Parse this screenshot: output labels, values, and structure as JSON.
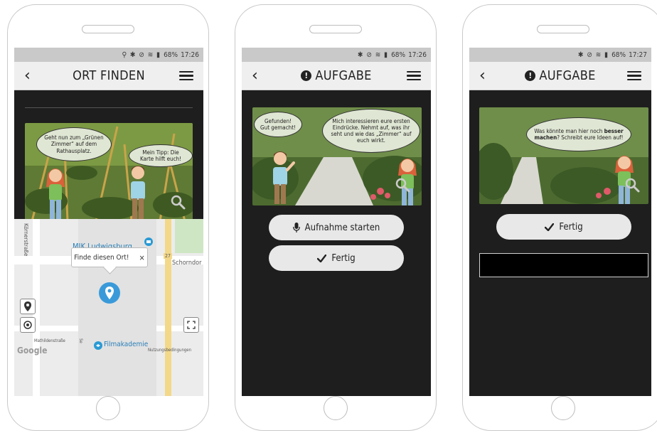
{
  "phones": [
    {
      "status": {
        "icons": "⚲ ✱ ⊘ ≋ ▮",
        "battery": "68%",
        "time": "17:26"
      },
      "title": "ORT FINDEN",
      "bubble1": "Geht nun zum „Grünen Zimmer“ auf dem Rathausplatz.",
      "bubble2": "Mein Tipp: Die Karte hilft euch!",
      "map": {
        "popup": "Finde diesen Ort!",
        "popup_close": "×",
        "poi_label": "MIK Ludwigsburg",
        "street_koerner": "Körnerstraße",
        "street_schorndorf": "Schorndor",
        "street_mathilden": "Mathildenstraße",
        "filmakademie": "Filmakademie",
        "road_number": "27",
        "google": "Google",
        "terms": "Nutzungsbedingungen",
        "street_bottom": "Se"
      }
    },
    {
      "status": {
        "icons": "✱ ⊘ ≋ ▮",
        "battery": "68%",
        "time": "17:26"
      },
      "title": "AUFGABE",
      "bubble1": "Gefunden! Gut gemacht!",
      "bubble2": "Mich interessieren eure ersten Eindrücke. Nehmt auf, was ihr seht und wie das „Zimmer“ auf euch wirkt.",
      "btn_record": "Aufnahme starten",
      "btn_done": "Fertig"
    },
    {
      "status": {
        "icons": "✱ ⊘ ≋ ▮",
        "battery": "68%",
        "time": "17:27"
      },
      "title": "AUFGABE",
      "bubble_a": "Was könnte man hier noch",
      "bubble_b": "besser machen",
      "bubble_c": "? Schreibt eure Ideen auf!",
      "btn_done": "Fertig",
      "textarea_value": ""
    }
  ],
  "colors": {
    "dark": "#1e1e1e",
    "appbar": "#efefef",
    "button": "#e8e8e8",
    "marker": "#3a9ad9"
  }
}
